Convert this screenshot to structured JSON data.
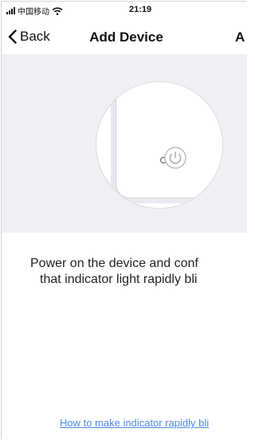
{
  "status_bar": {
    "carrier": "中国移动",
    "time": "21:19"
  },
  "nav": {
    "back_label": "Back",
    "title": "Add Device",
    "right_label": "A"
  },
  "illustration": {
    "icons": [
      "indicator-light-icon",
      "power-button-icon"
    ]
  },
  "instruction": {
    "line1": "Power on the device and conf",
    "line2": "that indicator light rapidly bli"
  },
  "help_link": {
    "text": "How to make indicator rapidly bli"
  },
  "colors": {
    "band_bg": "#efeff4",
    "link": "#4a8be8"
  }
}
